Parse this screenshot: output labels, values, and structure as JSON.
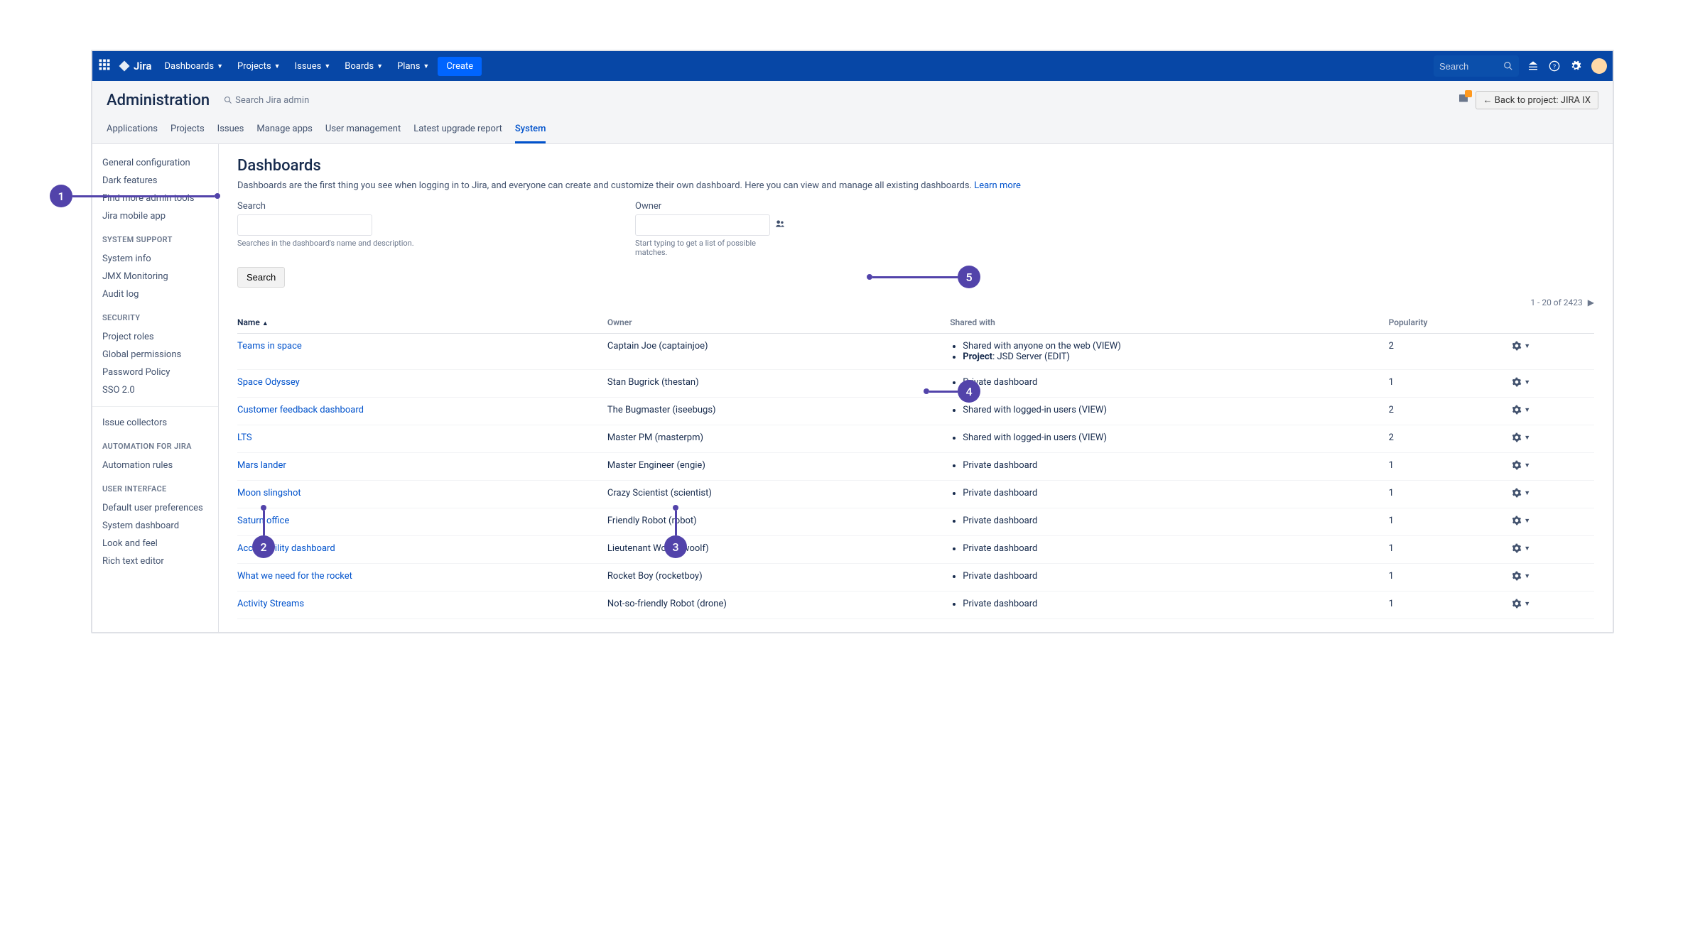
{
  "topnav": {
    "brand": "Jira",
    "menu": [
      "Dashboards",
      "Projects",
      "Issues",
      "Boards",
      "Plans"
    ],
    "create": "Create",
    "search_placeholder": "Search"
  },
  "admin": {
    "title": "Administration",
    "search_placeholder": "Search Jira admin",
    "back_label": "← Back to project: JIRA IX",
    "tabs": [
      "Applications",
      "Projects",
      "Issues",
      "Manage apps",
      "User management",
      "Latest upgrade report",
      "System"
    ],
    "active_tab": "System"
  },
  "sidebar": {
    "top": [
      "General configuration",
      "Dark features",
      "Find more admin tools",
      "Jira mobile app"
    ],
    "groups": [
      {
        "title": "SYSTEM SUPPORT",
        "items": [
          "System info",
          "JMX Monitoring",
          "Audit log"
        ]
      },
      {
        "title": "SECURITY",
        "items": [
          "Project roles",
          "Global permissions",
          "Password Policy",
          "SSO 2.0"
        ]
      }
    ],
    "mid": [
      "Issue collectors"
    ],
    "groups2": [
      {
        "title": "AUTOMATION FOR JIRA",
        "items": [
          "Automation rules"
        ]
      },
      {
        "title": "USER INTERFACE",
        "items": [
          "Default user preferences",
          "System dashboard",
          "Look and feel",
          "Rich text editor"
        ]
      }
    ]
  },
  "page": {
    "heading": "Dashboards",
    "desc": "Dashboards are the first thing you see when logging in to Jira, and everyone can create and customize their own dashboard. Here you can view and manage all existing dashboards. ",
    "learn_more": "Learn more",
    "search_label": "Search",
    "search_hint": "Searches in the dashboard's name and description.",
    "owner_label": "Owner",
    "owner_hint": "Start typing to get a list of possible matches.",
    "search_button": "Search",
    "pager": "1 - 20 of 2423",
    "columns": {
      "name": "Name",
      "owner": "Owner",
      "shared": "Shared with",
      "popularity": "Popularity"
    },
    "rows": [
      {
        "name": "Teams in space",
        "owner": "Captain Joe (captainjoe)",
        "shared": [
          "Shared with anyone on the web (VIEW)",
          "<b>Project</b>: JSD Server (EDIT)"
        ],
        "popularity": "2"
      },
      {
        "name": "Space Odyssey",
        "owner": "Stan Bugrick (thestan)",
        "shared": [
          "Private dashboard"
        ],
        "popularity": "1"
      },
      {
        "name": "Customer feedback dashboard",
        "owner": "The Bugmaster (iseebugs)",
        "shared": [
          "Shared with logged-in users (VIEW)"
        ],
        "popularity": "2"
      },
      {
        "name": "LTS",
        "owner": "Master PM (masterpm)",
        "shared": [
          "Shared with logged-in users (VIEW)"
        ],
        "popularity": "2"
      },
      {
        "name": "Mars lander",
        "owner": "Master Engineer (engie)",
        "shared": [
          "Private dashboard"
        ],
        "popularity": "1"
      },
      {
        "name": "Moon slingshot",
        "owner": "Crazy Scientist (scientist)",
        "shared": [
          "Private dashboard"
        ],
        "popularity": "1"
      },
      {
        "name": "Saturn office",
        "owner": "Friendly Robot (robot)",
        "shared": [
          "Private dashboard"
        ],
        "popularity": "1"
      },
      {
        "name": "Accessibility dashboard",
        "owner": "Lieutenant Woolf (woolf)",
        "shared": [
          "Private dashboard"
        ],
        "popularity": "1"
      },
      {
        "name": "What we need for the rocket",
        "owner": "Rocket Boy (rocketboy)",
        "shared": [
          "Private dashboard"
        ],
        "popularity": "1"
      },
      {
        "name": "Activity Streams",
        "owner": "Not-so-friendly Robot (drone)",
        "shared": [
          "Private dashboard"
        ],
        "popularity": "1"
      }
    ]
  },
  "annotations": {
    "1": "1",
    "2": "2",
    "3": "3",
    "4": "4",
    "5": "5"
  }
}
